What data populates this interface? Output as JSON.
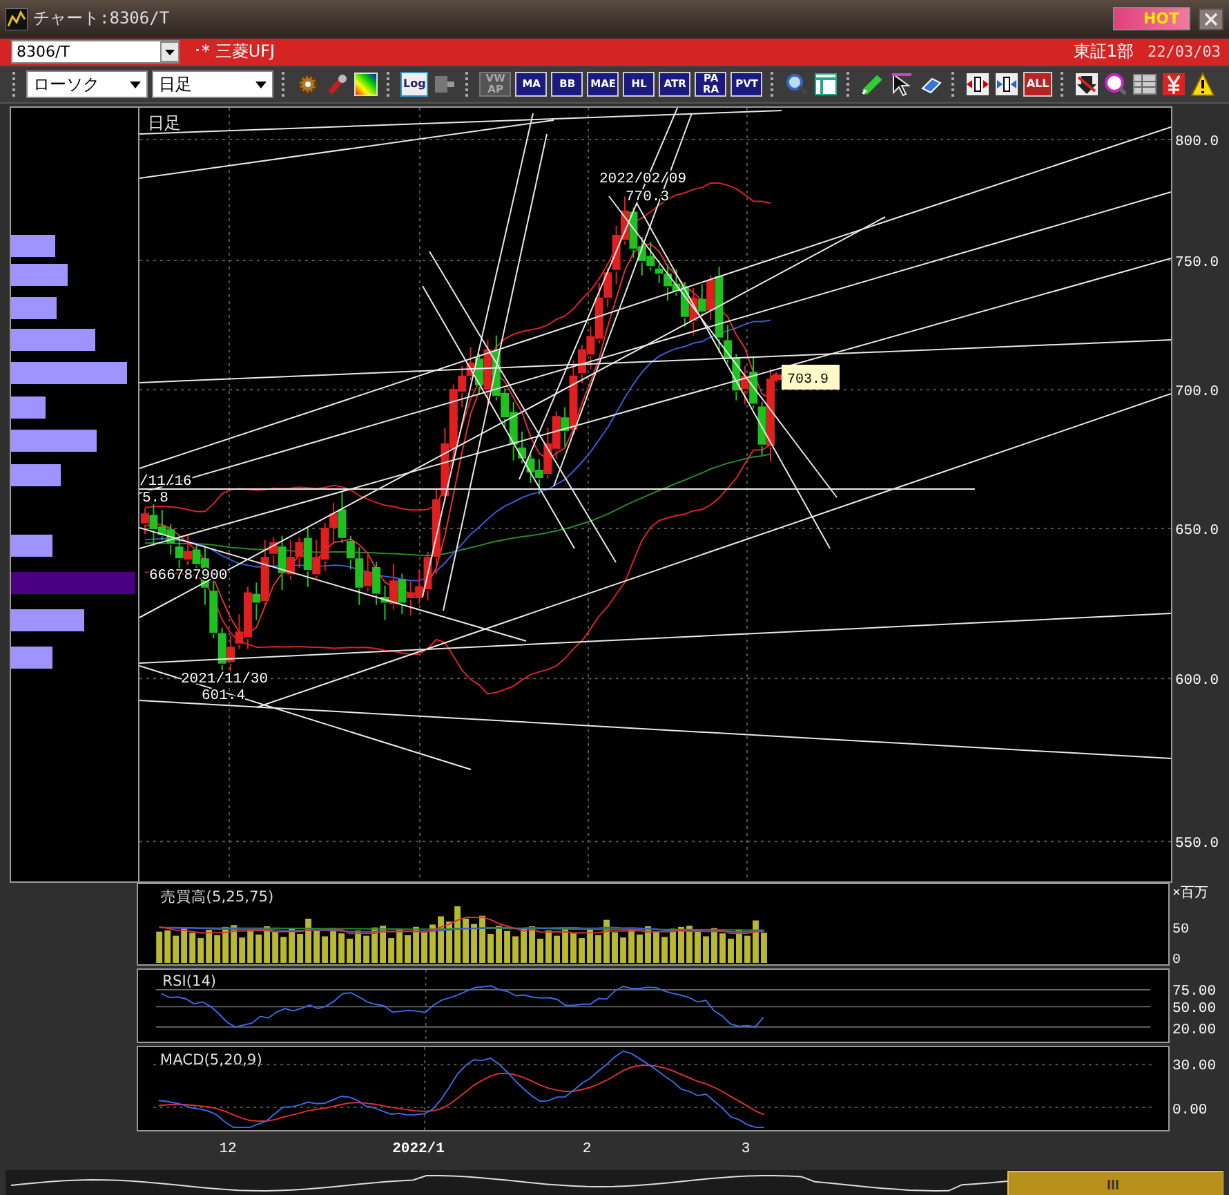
{
  "window": {
    "title": "チャート:8306/T",
    "hot_button": "HOT"
  },
  "symbol_bar": {
    "code": "8306/T",
    "name": "･* 三菱UFJ",
    "market": "東証1部",
    "date": "22/03/03"
  },
  "toolbar": {
    "chart_type": "ローソク",
    "period": "日足",
    "log_button": {
      "label": "Log"
    },
    "indicator_buttons": [
      {
        "label": "VW AP",
        "disabled": true
      },
      {
        "label": "MA",
        "disabled": false
      },
      {
        "label": "BB",
        "disabled": false
      },
      {
        "label": "MAE",
        "disabled": false
      },
      {
        "label": "HL",
        "disabled": false
      },
      {
        "label": "ATR",
        "disabled": false
      },
      {
        "label": "PA RA",
        "disabled": false
      },
      {
        "label": "PVT",
        "disabled": false
      }
    ],
    "all_button": {
      "label": "ALL"
    }
  },
  "price_chart": {
    "period_label": "日足",
    "price_axis": [
      "800.0",
      "750.0",
      "700.0",
      "650.0",
      "600.0",
      "550.0"
    ],
    "annotations": [
      {
        "date": "2022/02/09",
        "price": "770.3"
      },
      {
        "date": "2021/11/30",
        "price": "601.4"
      },
      {
        "date": "/11/16",
        "price": "5.8"
      }
    ],
    "volume_label": "666787900",
    "last_price": "703.9"
  },
  "volume_panel": {
    "title": "売買高(5,25,75)",
    "axis": [
      "×百万",
      "50",
      "0"
    ]
  },
  "rsi_panel": {
    "title": "RSI(14)",
    "axis": [
      "75.00",
      "50.00",
      "20.00"
    ]
  },
  "macd_panel": {
    "title": "MACD(5,20,9)",
    "axis": [
      "30.00",
      "0.00"
    ]
  },
  "x_axis": [
    {
      "label": "12",
      "bold": false
    },
    {
      "label": "2022/1",
      "bold": true
    },
    {
      "label": "2",
      "bold": false
    },
    {
      "label": "3",
      "bold": false
    }
  ]
}
